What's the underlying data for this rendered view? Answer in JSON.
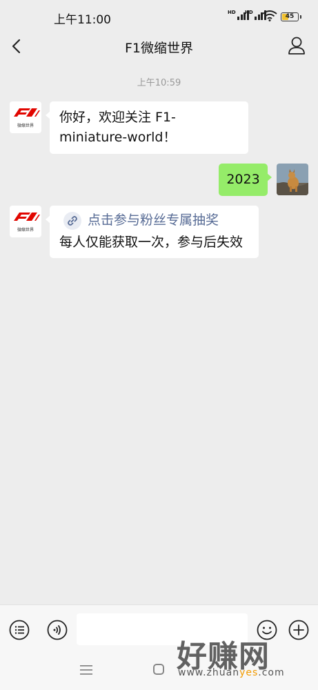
{
  "status_bar": {
    "time": "上午11:00",
    "battery": "45",
    "battery_level": 0.45,
    "network": [
      "HD",
      "HD"
    ]
  },
  "header": {
    "title": "F1微缩世界",
    "back_icon": "chevron-left-icon",
    "profile_icon": "person-icon"
  },
  "chat": {
    "timestamp": "上午10:59",
    "messages": [
      {
        "from": "official",
        "text": "你好，欢迎关注 F1-miniature-world！"
      },
      {
        "from": "me",
        "text": "2023"
      },
      {
        "from": "official",
        "link_text": "点击参与粉丝专属抽奖",
        "text": "每人仅能获取一次，参与后失效"
      }
    ],
    "official_avatar_label": "微缩世界"
  },
  "input_bar": {
    "left_icons": [
      "menu-list-icon",
      "voice-icon"
    ],
    "right_icons": [
      "emoji-icon",
      "plus-icon"
    ],
    "value": ""
  },
  "watermark": {
    "text": "好赚网",
    "url_prefix": "www.zhuan",
    "url_highlight": "yes",
    "url_suffix": ".com"
  },
  "colors": {
    "background": "#ededed",
    "bubble_mine": "#95ec69",
    "link": "#576b95",
    "f1_red": "#e10600"
  }
}
